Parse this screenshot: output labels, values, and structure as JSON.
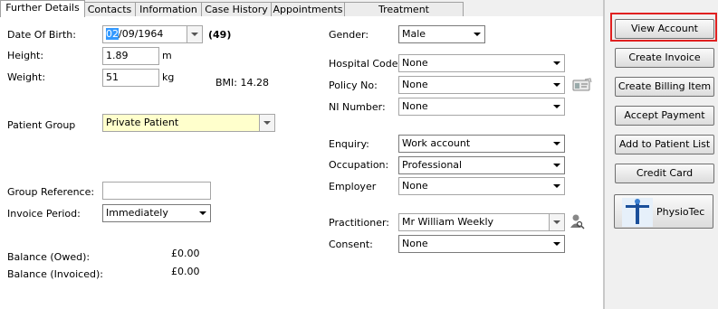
{
  "tabs": [
    "Further Details",
    "Contacts",
    "Information",
    "Case History",
    "Appointments",
    "Treatment Authorisation"
  ],
  "left": {
    "dob_label": "Date Of Birth:",
    "dob_day": "02",
    "dob_rest": "/09/1964",
    "age": "(49)",
    "height_label": "Height:",
    "height_value": "1.89",
    "height_unit": "m",
    "weight_label": "Weight:",
    "weight_value": "51",
    "weight_unit": "kg",
    "bmi": "BMI: 14.28",
    "patient_group_label": "Patient Group",
    "patient_group_value": "Private Patient",
    "group_ref_label": "Group Reference:",
    "group_ref_value": "",
    "invoice_period_label": "Invoice Period:",
    "invoice_period_value": "Immediately",
    "balance_owed_label": "Balance (Owed):",
    "balance_owed_value": "£0.00",
    "balance_invoiced_label": "Balance (Invoiced):",
    "balance_invoiced_value": "£0.00"
  },
  "right": {
    "gender_label": "Gender:",
    "gender_value": "Male",
    "hospital_code_label": "Hospital Code:",
    "hospital_code_value": "None",
    "policy_no_label": "Policy No:",
    "policy_no_value": "None",
    "ni_number_label": "NI Number:",
    "ni_number_value": "None",
    "enquiry_label": "Enquiry:",
    "enquiry_value": "Work account",
    "occupation_label": "Occupation:",
    "occupation_value": "Professional",
    "employer_label": "Employer",
    "employer_value": "None",
    "practitioner_label": "Practitioner:",
    "practitioner_value": "Mr William Weekly",
    "consent_label": "Consent:",
    "consent_value": "None"
  },
  "sidebar": {
    "buttons": [
      "View Account",
      "Create Invoice",
      "Create Billing Item",
      "Accept Payment",
      "Add to Patient List",
      "Credit Card"
    ],
    "physiotec_label": "PhysioTec"
  }
}
